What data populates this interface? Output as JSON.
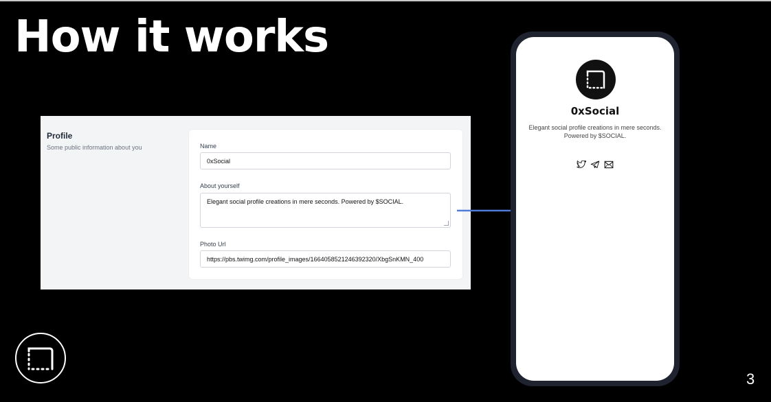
{
  "slide": {
    "title": "How it works",
    "page_number": "3"
  },
  "form": {
    "section_title": "Profile",
    "section_subtitle": "Some public information about you",
    "name_label": "Name",
    "name_value": "0xSocial",
    "about_label": "About yourself",
    "about_value": "Elegant social profile creations in mere seconds. Powered by $SOCIAL.",
    "photo_label": "Photo Url",
    "photo_value": "https://pbs.twimg.com/profile_images/1664058521246392320/XbgSnKMN_400"
  },
  "phone": {
    "profile_name": "0xSocial",
    "bio_line1": "Elegant social profile creations in mere seconds.",
    "bio_line2": "Powered by $SOCIAL.",
    "social_icons": [
      "twitter-icon",
      "telegram-icon",
      "email-icon"
    ]
  },
  "colors": {
    "background": "#000000",
    "arrow": "#4f7bd9",
    "phone_frame": "#1f2330"
  }
}
